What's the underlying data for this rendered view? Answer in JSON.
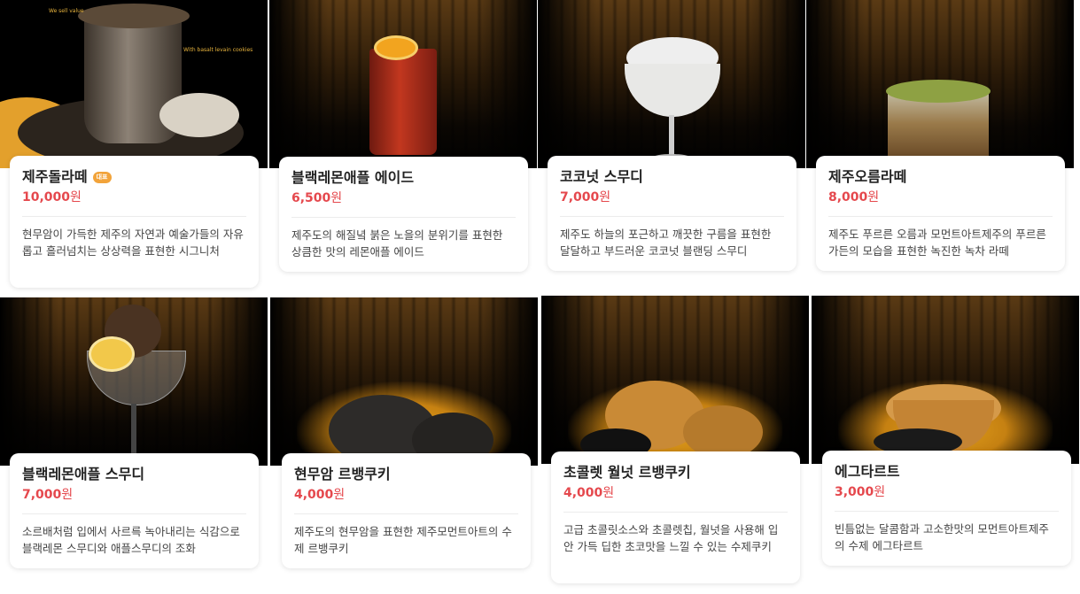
{
  "banner_text": {
    "left": "We sell value",
    "right": "With basalt levain cookies"
  },
  "colors": {
    "price": "#e5484d",
    "badge": "#f2a33a",
    "spotlight": "#f0aa1e"
  },
  "products": [
    {
      "name": "제주돌라떼",
      "badge": "대표",
      "price_num": "10,000",
      "price_unit": "원",
      "description": "현무암이 가득한 제주의 자연과 예술가들의 자유롭고 흘러넘치는 상상력을 표현한 시그니처",
      "image_icon": "stone-latte-icon"
    },
    {
      "name": "블랙레몬애플 에이드",
      "price_num": "6,500",
      "price_unit": "원",
      "description": "제주도의 해질녘 붉은 노을의 분위기를 표현한 상큼한 맛의 레몬애플 에이드",
      "image_icon": "ade-glass-icon"
    },
    {
      "name": "코코넛 스무디",
      "price_num": "7,000",
      "price_unit": "원",
      "description": "제주도 하늘의 포근하고 깨끗한 구름을 표현한 달달하고 부드러운 코코넛 블랜딩 스무디",
      "image_icon": "coconut-smoothie-icon"
    },
    {
      "name": "제주오름라떼",
      "price_num": "8,000",
      "price_unit": "원",
      "description": "제주도 푸르른 오름과 모먼트아트제주의 푸르른 가든의 모습을 표현한 녹진한 녹차 라떼",
      "image_icon": "green-tea-latte-icon"
    },
    {
      "name": "블랙레몬애플 스무디",
      "price_num": "7,000",
      "price_unit": "원",
      "description": "소르배처럼 입에서 사르륵 녹아내리는 식감으로 블랙레몬 스무디와 애플스무디의 조화",
      "image_icon": "black-smoothie-icon"
    },
    {
      "name": "현무암 르뱅쿠키",
      "price_num": "4,000",
      "price_unit": "원",
      "description": "제주도의 현무암을 표현한 제주모먼트아트의 수제 르뱅쿠키",
      "image_icon": "basalt-cookie-icon"
    },
    {
      "name": "초콜렛 월넛 르뱅쿠키",
      "price_num": "4,000",
      "price_unit": "원",
      "description": "고급 초콜릿소스와 초콜렛칩, 월넛을 사용해 입안 가득 딥한 초코맛을 느낄 수 있는 수제쿠키",
      "image_icon": "chocolate-cookie-icon"
    },
    {
      "name": "에그타르트",
      "price_num": "3,000",
      "price_unit": "원",
      "description": "빈틈없는 달콤함과 고소한맛의 모먼트아트제주의 수제 에그타르트",
      "image_icon": "egg-tart-icon"
    }
  ]
}
